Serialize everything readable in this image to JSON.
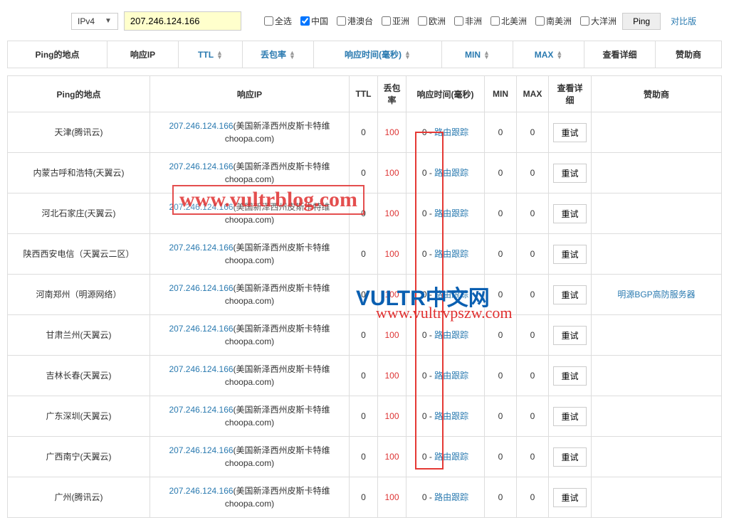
{
  "topbar": {
    "ip_version": "IPv4",
    "ip_value": "207.246.124.166",
    "checkboxes": [
      {
        "label": "全选",
        "checked": false
      },
      {
        "label": "中国",
        "checked": true
      },
      {
        "label": "港澳台",
        "checked": false
      },
      {
        "label": "亚洲",
        "checked": false
      },
      {
        "label": "欧洲",
        "checked": false
      },
      {
        "label": "非洲",
        "checked": false
      },
      {
        "label": "北美洲",
        "checked": false
      },
      {
        "label": "南美洲",
        "checked": false
      },
      {
        "label": "大洋洲",
        "checked": false
      }
    ],
    "ping_btn": "Ping",
    "compare_link": "对比版"
  },
  "header": [
    {
      "label": "Ping的地点",
      "sortable": false,
      "w": 140
    },
    {
      "label": "响应IP",
      "sortable": false,
      "w": 100
    },
    {
      "label": "TTL",
      "sortable": true,
      "w": 90
    },
    {
      "label": "丢包率",
      "sortable": true,
      "w": 100
    },
    {
      "label": "响应时间(毫秒)",
      "sortable": true,
      "w": 180
    },
    {
      "label": "MIN",
      "sortable": true,
      "w": 100
    },
    {
      "label": "MAX",
      "sortable": true,
      "w": 100
    },
    {
      "label": "查看详细",
      "sortable": false,
      "w": 100
    },
    {
      "label": "赞助商",
      "sortable": false,
      "w": 100
    }
  ],
  "table_header": {
    "location": "Ping的地点",
    "ip": "响应IP",
    "ttl": "TTL",
    "loss": "丢包率",
    "resp": "响应时间(毫秒)",
    "min": "MIN",
    "max": "MAX",
    "detail": "查看详细",
    "sponsor": "赞助商"
  },
  "ip_text": "207.246.124.166",
  "ip_desc": "(美国新泽西州皮斯卡特维 choopa.com)",
  "route_trace": "路由跟踪",
  "retry": "重试",
  "rows": [
    {
      "location": "天津(腾讯云)",
      "ttl": "0",
      "loss": "100",
      "resp": "0",
      "min": "0",
      "max": "0",
      "sponsor": ""
    },
    {
      "location": "内蒙古呼和浩特(天翼云)",
      "ttl": "0",
      "loss": "100",
      "resp": "0",
      "min": "0",
      "max": "0",
      "sponsor": ""
    },
    {
      "location": "河北石家庄(天翼云)",
      "ttl": "0",
      "loss": "100",
      "resp": "0",
      "min": "0",
      "max": "0",
      "sponsor": ""
    },
    {
      "location": "陕西西安电信（天翼云二区）",
      "ttl": "0",
      "loss": "100",
      "resp": "0",
      "min": "0",
      "max": "0",
      "sponsor": ""
    },
    {
      "location": "河南郑州（明源网络）",
      "ttl": "0",
      "loss": "100",
      "resp": "0",
      "min": "0",
      "max": "0",
      "sponsor": "明源BGP高防服务器"
    },
    {
      "location": "甘肃兰州(天翼云)",
      "ttl": "0",
      "loss": "100",
      "resp": "0",
      "min": "0",
      "max": "0",
      "sponsor": ""
    },
    {
      "location": "吉林长春(天翼云)",
      "ttl": "0",
      "loss": "100",
      "resp": "0",
      "min": "0",
      "max": "0",
      "sponsor": ""
    },
    {
      "location": "广东深圳(天翼云)",
      "ttl": "0",
      "loss": "100",
      "resp": "0",
      "min": "0",
      "max": "0",
      "sponsor": ""
    },
    {
      "location": "广西南宁(天翼云)",
      "ttl": "0",
      "loss": "100",
      "resp": "0",
      "min": "0",
      "max": "0",
      "sponsor": ""
    },
    {
      "location": "广州(腾讯云)",
      "ttl": "0",
      "loss": "100",
      "resp": "0",
      "min": "0",
      "max": "0",
      "sponsor": ""
    }
  ],
  "watermarks": {
    "w1": "www.vultrblog.com",
    "w2": "VULTR中文网",
    "w3": "www.vultrvpszw.com"
  }
}
